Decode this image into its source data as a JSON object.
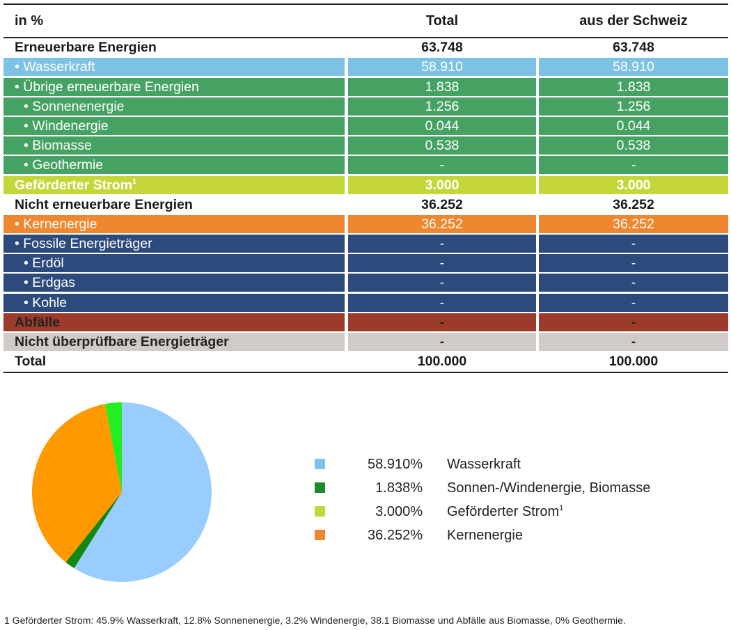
{
  "table": {
    "headers": [
      "in %",
      "Total",
      "aus der Schweiz"
    ],
    "rows": [
      {
        "label": "Erneuerbare Energien",
        "total": "63.748",
        "ch": "63.748",
        "bg": "#ffffff",
        "bold": true
      },
      {
        "label": "• Wasserkraft",
        "total": "58.910",
        "ch": "58.910",
        "bg": "#7dc2e5"
      },
      {
        "label": "• Übrige erneuerbare Energien",
        "total": "1.838",
        "ch": "1.838",
        "bg": "#46a263"
      },
      {
        "label": "• Sonnenenergie",
        "total": "1.256",
        "ch": "1.256",
        "bg": "#46a263",
        "indent": 2
      },
      {
        "label": "• Windenergie",
        "total": "0.044",
        "ch": "0.044",
        "bg": "#46a263",
        "indent": 2
      },
      {
        "label": "• Biomasse",
        "total": "0.538",
        "ch": "0.538",
        "bg": "#46a263",
        "indent": 2
      },
      {
        "label": "• Geothermie",
        "total": "-",
        "ch": "-",
        "bg": "#46a263",
        "indent": 2
      },
      {
        "label": "Geförderter Strom",
        "sup": "1",
        "total": "3.000",
        "ch": "3.000",
        "bg": "#c5d638",
        "bold": true
      },
      {
        "label": "Nicht erneuerbare Energien",
        "total": "36.252",
        "ch": "36.252",
        "bg": "#ffffff",
        "bold": true
      },
      {
        "label": "• Kernenergie",
        "total": "36.252",
        "ch": "36.252",
        "bg": "#ef8731"
      },
      {
        "label": "• Fossile Energieträger",
        "total": "-",
        "ch": "-",
        "bg": "#2c4a7c"
      },
      {
        "label": "• Erdöl",
        "total": "-",
        "ch": "-",
        "bg": "#2c4a7c",
        "indent": 2
      },
      {
        "label": "• Erdgas",
        "total": "-",
        "ch": "-",
        "bg": "#2c4a7c",
        "indent": 2
      },
      {
        "label": "• Kohle",
        "total": "-",
        "ch": "-",
        "bg": "#2c4a7c",
        "indent": 2
      },
      {
        "label": "Abfälle",
        "total": "-",
        "ch": "-",
        "bg": "#9c3b2c",
        "bold": true,
        "dark_text": true
      },
      {
        "label": "Nicht überprüfbare Energieträger",
        "total": "-",
        "ch": "-",
        "bg": "#d0cbc8",
        "bold": true,
        "dark_text": true
      },
      {
        "label": "Total",
        "total": "100.000",
        "ch": "100.000",
        "bg": "#ffffff",
        "bold": true
      }
    ]
  },
  "chart_data": {
    "type": "pie",
    "slices": [
      {
        "label": "Wasserkraft",
        "value": 58.91,
        "display": "58.910%",
        "color": "#99ccff",
        "legend_color": "#7dc2e5"
      },
      {
        "label": "Sonnen-/Windenergie, Biomasse",
        "value": 1.838,
        "display": "1.838%",
        "color": "#118811",
        "legend_color": "#1e8a2e"
      },
      {
        "label": "Kernenergie",
        "value": 36.252,
        "display": "36.252%",
        "color": "#ff9900",
        "legend_color": "#ef8731"
      },
      {
        "label": "Geförderter Strom",
        "value": 3.0,
        "display": "3.000%",
        "color": "#22ee22",
        "legend_color": "#c5d638"
      }
    ],
    "legend": [
      {
        "value": "58.910%",
        "label": "Wasserkraft",
        "color": "#7dc2e5"
      },
      {
        "value": "1.838%",
        "label": "Sonnen-/Windenergie, Biomasse",
        "color": "#1e8a2e"
      },
      {
        "value": "3.000%",
        "label": "Geförderter Strom",
        "sup": "1",
        "color": "#c5d638"
      },
      {
        "value": "36.252%",
        "label": "Kernenergie",
        "color": "#ef8731"
      }
    ]
  },
  "footnote": "1 Geförderter Strom: 45.9% Wasserkraft, 12.8% Sonnenenergie, 3.2% Windenergie, 38.1 Biomasse und Abfälle aus Biomasse, 0% Geothermie."
}
